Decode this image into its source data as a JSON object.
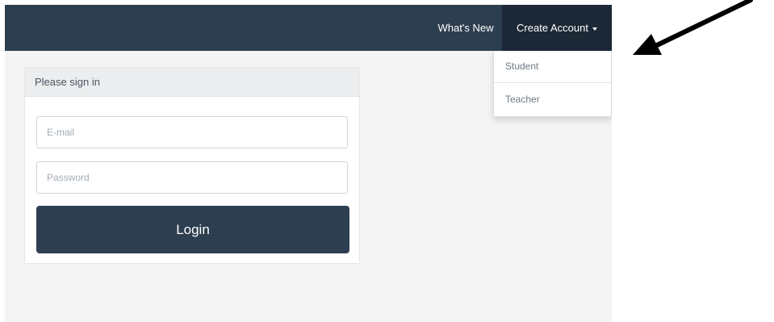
{
  "navbar": {
    "whats_new_label": "What's New",
    "create_account_label": "Create Account",
    "bg_color": "#2d3e50",
    "active_bg_color": "#1c2835"
  },
  "dropdown": {
    "items": [
      {
        "label": "Student"
      },
      {
        "label": "Teacher"
      }
    ]
  },
  "signin": {
    "heading": "Please sign in",
    "email_placeholder": "E-mail",
    "password_placeholder": "Password",
    "login_label": "Login"
  },
  "annotation": {
    "arrow_color": "#000000",
    "icon": "pointing-arrow-icon"
  }
}
